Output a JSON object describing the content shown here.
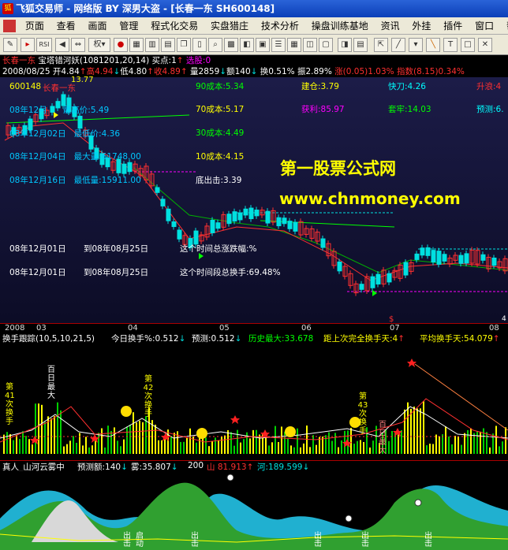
{
  "window": {
    "title": "飞狐交易师 - 网络版 BY 深男大盗 - [长春一东 SH600148]"
  },
  "menu": [
    "页面",
    "查看",
    "画面",
    "管理",
    "程式化交易",
    "实盘猎庄",
    "技术分析",
    "操盘训练基地",
    "资讯",
    "外挂",
    "插件",
    "窗口",
    "帮助"
  ],
  "toolbar": {
    "quan_label": "权"
  },
  "info": {
    "stock_name": "长春一东",
    "formula": "宝塔错河妖(1081201,20,14)",
    "buy_point": "买点:1",
    "buy_point_arrow": "↑",
    "select": "选股:0",
    "date": "2008/08/25",
    "open_label": "开",
    "open": "4.84",
    "open_arrow": "↑",
    "high_label": "高",
    "high": "4.94",
    "high_arrow": "↓",
    "low_label": "低",
    "low": "4.80",
    "low_arrow": "↑",
    "close_label": "收",
    "close": "4.89",
    "close_arrow": "↑",
    "volume": "量2859",
    "volume_arrow": "↓",
    "amount": "额140",
    "amount_arrow": "↓",
    "turnover": "换0.51%",
    "amplitude": "振2.89%",
    "change": "涨(0.05)1.03%",
    "index": "指数(8.15)0.34%"
  },
  "main": {
    "code_label": "600148",
    "name_label": "长春一东",
    "peak_price": "13.77",
    "date_rows": [
      {
        "date": "08年12月",
        "label": "最高价",
        "value": "5.49"
      },
      {
        "date": "08年12月02日",
        "label": "最低价",
        "value": "4.36"
      },
      {
        "date": "08年12月04日",
        "label": "最大量",
        "value": "61748.00"
      },
      {
        "date": "08年12月16日",
        "label": "最低量",
        "value": "15911.00"
      }
    ],
    "costs": [
      {
        "label": "90成本",
        "value": "5.34"
      },
      {
        "label": "70成本",
        "value": "5.17"
      },
      {
        "label": "30成本",
        "value": "4.49"
      },
      {
        "label": "10成本",
        "value": "4.15"
      }
    ],
    "bottom_out": "底出击:3.39",
    "signals": [
      {
        "label": "建仓",
        "value": "3.79"
      },
      {
        "label": "快刀",
        "value": "4.26"
      },
      {
        "label": "升浪",
        "value": "4"
      },
      {
        "label": "获利",
        "value": "85.97"
      },
      {
        "label": "套牢",
        "value": "14.03"
      },
      {
        "label": "预测",
        "value": "6."
      }
    ],
    "period1": {
      "from": "08年12月01日",
      "to": "到08年08月25日",
      "label": "这个时间总涨跌幅:%"
    },
    "period2": {
      "from": "08年12月01日",
      "to": "到08年08月25日",
      "label": "这个时间段总换手:69.48%"
    },
    "watermark1": "第一股票公式网",
    "watermark2": "www.chnmoney.com"
  },
  "axis": {
    "labels": [
      "2008",
      "03",
      "04",
      "05",
      "06",
      "07",
      "08"
    ],
    "marker": "$",
    "right_num": "4"
  },
  "ind1": {
    "title": "换手跟踪(10,5,10,21,5)",
    "today": "今日换手%:0.512",
    "today_arrow": "↓",
    "predict": "预测:0.512",
    "predict_arrow": "↓",
    "hist_max": "历史最大:33.678",
    "since": "距上次完全换手天:4",
    "since_arrow": "↑",
    "avg": "平均换手天:54.079",
    "avg_arrow": "↑",
    "rank_labels": [
      "第",
      "41",
      "次",
      "换手",
      "第",
      "42",
      "次",
      "换手",
      "第",
      "43",
      "次",
      "换手"
    ],
    "big_labels": [
      "百",
      "日",
      "最",
      "大",
      "百",
      "日",
      "最",
      "大"
    ]
  },
  "ind2": {
    "title": "真人_山河云雾中",
    "predict": "预测额:140",
    "predict_arrow": "↓",
    "fog": "雾:35.807",
    "fog_arrow": "↓",
    "val": "200",
    "mountain": "山 81.913",
    "mountain_arrow": "↑",
    "river": "河:189.599",
    "river_arrow": "↓",
    "chu_labels": [
      "出",
      "击",
      "启",
      "动",
      "出",
      "击",
      "出",
      "击",
      "出",
      "击",
      "出",
      "击"
    ]
  },
  "colors": {
    "up": "#ff3030",
    "down": "#00e0e0",
    "yellow": "#ffff00",
    "green": "#00ff00",
    "magenta": "#ff00ff",
    "cyan": "#00ffff",
    "white": "#ffffff"
  }
}
